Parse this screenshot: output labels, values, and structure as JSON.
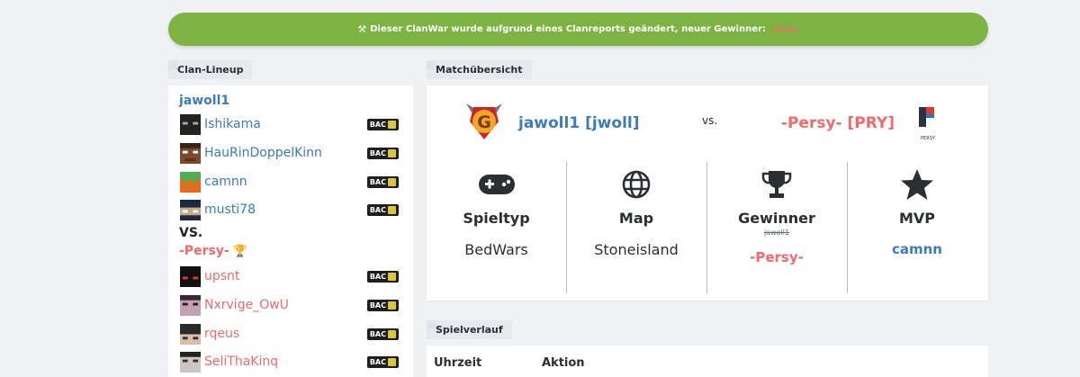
{
  "banner": {
    "text": "Dieser ClanWar wurde aufgrund eines Clanreports geändert, neuer Gewinner:",
    "winner": "-Persy-",
    "color": "#7cb342"
  },
  "lineup": {
    "title": "Clan-Lineup",
    "team_a": {
      "name": "jawoll1",
      "players": [
        "Ishikama",
        "HauRinDoppelKinn",
        "camnn",
        "musti78"
      ]
    },
    "vs": "VS.",
    "team_b": {
      "name": "-Persy-",
      "players": [
        "upsnt",
        "Nxrvige_OwU",
        "rqeus",
        "SeliThaKinq"
      ]
    },
    "badge": "BAC"
  },
  "match": {
    "title": "Matchübersicht",
    "team_a": "jawoll1 [jwoll]",
    "vs": "vs.",
    "team_b": "-Persy- [PRY]",
    "team_b_logo_text": "PERSY",
    "stats": {
      "spieltyp_label": "Spieltyp",
      "spieltyp_value": "BedWars",
      "map_label": "Map",
      "map_value": "Stoneisland",
      "gewinner_label": "Gewinner",
      "gewinner_old": "jawoll1",
      "gewinner_new": "-Persy-",
      "mvp_label": "MVP",
      "mvp_value": "camnn"
    }
  },
  "verlauf": {
    "title": "Spielverlauf",
    "col_time": "Uhrzeit",
    "col_action": "Aktion"
  },
  "colors": {
    "blue": "#3b7bbf",
    "red": "#f06a6a",
    "green": "#7cb342"
  }
}
